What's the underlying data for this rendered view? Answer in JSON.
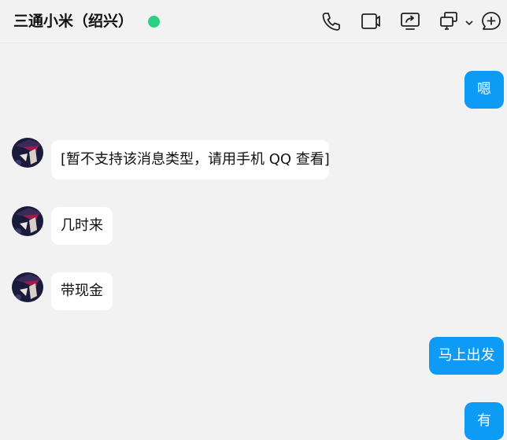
{
  "header": {
    "title": "三通小米（绍兴）",
    "online_color": "#29d181",
    "icons": [
      "phone-icon",
      "video-call-icon",
      "screen-share-icon",
      "remote-desktop-icon",
      "chevron-down-icon",
      "add-circle-icon"
    ]
  },
  "colors": {
    "outgoing_bubble": "#0d9bf5",
    "incoming_bubble": "#ffffff"
  },
  "messages": [
    {
      "direction": "out",
      "text": "嗯"
    },
    {
      "direction": "in",
      "text": "[暂不支持该消息类型，请用手机 QQ 查看]"
    },
    {
      "direction": "in",
      "text": "几时来"
    },
    {
      "direction": "in",
      "text": "带现金"
    },
    {
      "direction": "out",
      "text": "马上出发"
    },
    {
      "direction": "out",
      "text": "有"
    }
  ]
}
